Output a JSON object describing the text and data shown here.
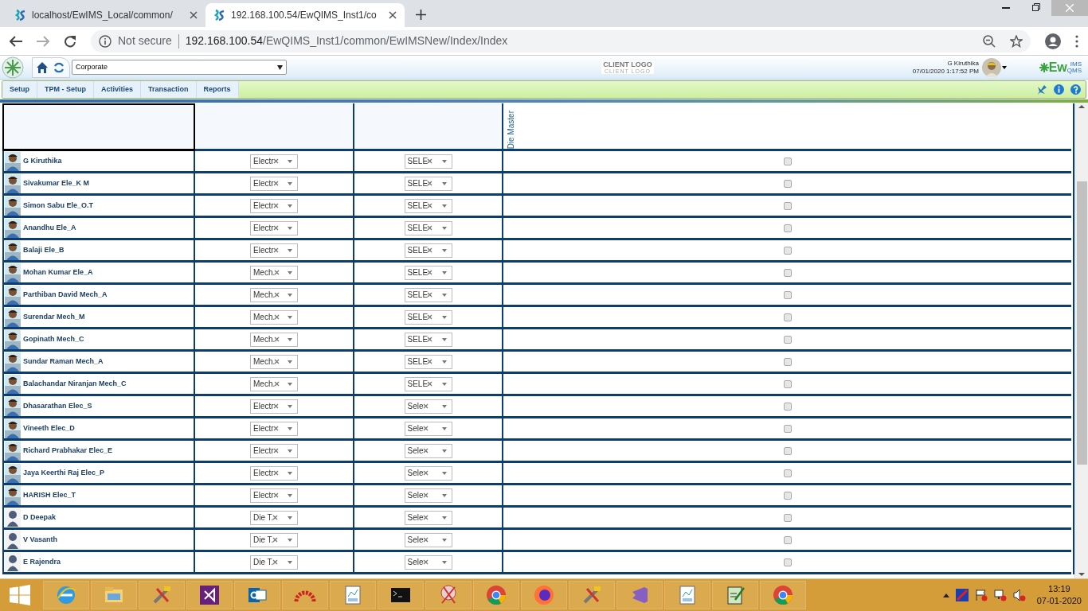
{
  "browser": {
    "tabs": [
      {
        "title": "localhost/EwIMS_Local/common/",
        "selected": false
      },
      {
        "title": "192.168.100.54/EwQIMS_Inst1/co",
        "selected": true
      }
    ],
    "security": "Not secure",
    "url_host": "192.168.100.54",
    "url_path": "/EwQIMS_Inst1/common/EwIMSNew/Index/Index"
  },
  "app": {
    "org_select": "Corporate",
    "client_logo": "CLIENT LOGO",
    "client_logo_sub": "CLIENT LOGO",
    "user": "G Kiruthika",
    "datetime": "07/01/2020 1:17:52 PM",
    "brand": "Ew",
    "brand_sup": "IMS",
    "brand_sub": "QMS"
  },
  "menu": [
    {
      "label": "Setup"
    },
    {
      "label": "TPM - Setup"
    },
    {
      "label": "Activities"
    },
    {
      "label": "Transaction"
    },
    {
      "label": "Reports"
    }
  ],
  "table": {
    "column_4": "Die Master",
    "rows": [
      {
        "name": "G Kiruthika",
        "dept": "Electr",
        "grade": "SELE",
        "checked": false
      },
      {
        "name": "Sivakumar Ele_K M",
        "dept": "Electr",
        "grade": "SELE",
        "checked": false
      },
      {
        "name": "Simon  Sabu Ele_O.T",
        "dept": "Electr",
        "grade": "SELE",
        "checked": false
      },
      {
        "name": "Anandhu Ele_A",
        "dept": "Electr",
        "grade": "SELE",
        "checked": false
      },
      {
        "name": "Balaji Ele_B",
        "dept": "Electr",
        "grade": "SELE",
        "checked": false
      },
      {
        "name": "Mohan Kumar Ele_A",
        "dept": "Mech.",
        "grade": "SELE",
        "checked": false
      },
      {
        "name": "Parthiban David Mech_A",
        "dept": "Mech.",
        "grade": "SELE",
        "checked": false
      },
      {
        "name": "Surendar Mech_M",
        "dept": "Mech.",
        "grade": "SELE",
        "checked": false
      },
      {
        "name": "Gopinath Mech_C",
        "dept": "Mech.",
        "grade": "SELE",
        "checked": false
      },
      {
        "name": "Sundar Raman Mech_A",
        "dept": "Mech.",
        "grade": "SELE",
        "checked": false
      },
      {
        "name": "Balachandar Niranjan Mech_C",
        "dept": "Mech.",
        "grade": "SELE",
        "checked": false
      },
      {
        "name": "Dhasarathan Elec_S",
        "dept": "Electr",
        "grade": "Sele",
        "checked": false
      },
      {
        "name": "Vineeth Elec_D",
        "dept": "Electr",
        "grade": "Sele",
        "checked": false
      },
      {
        "name": "Richard Prabhakar Elec_E",
        "dept": "Electr",
        "grade": "Sele",
        "checked": false
      },
      {
        "name": "Jaya Keerthi Raj Elec_P",
        "dept": "Electr",
        "grade": "Sele",
        "checked": false
      },
      {
        "name": "HARISH Elec_T",
        "dept": "Electr",
        "grade": "Sele",
        "checked": false
      },
      {
        "kind": "silhouette",
        "name": "D Deepak",
        "dept": "Die T.",
        "grade": "Sele",
        "checked": false
      },
      {
        "kind": "silhouette",
        "name": "V Vasanth",
        "dept": "Die T.",
        "grade": "Sele",
        "checked": false
      },
      {
        "kind": "silhouette",
        "name": "E Rajendra",
        "dept": "Die T.",
        "grade": "Sele",
        "checked": false
      }
    ]
  },
  "taskbar": {
    "time": "13:19",
    "date": "07-01-2020"
  }
}
